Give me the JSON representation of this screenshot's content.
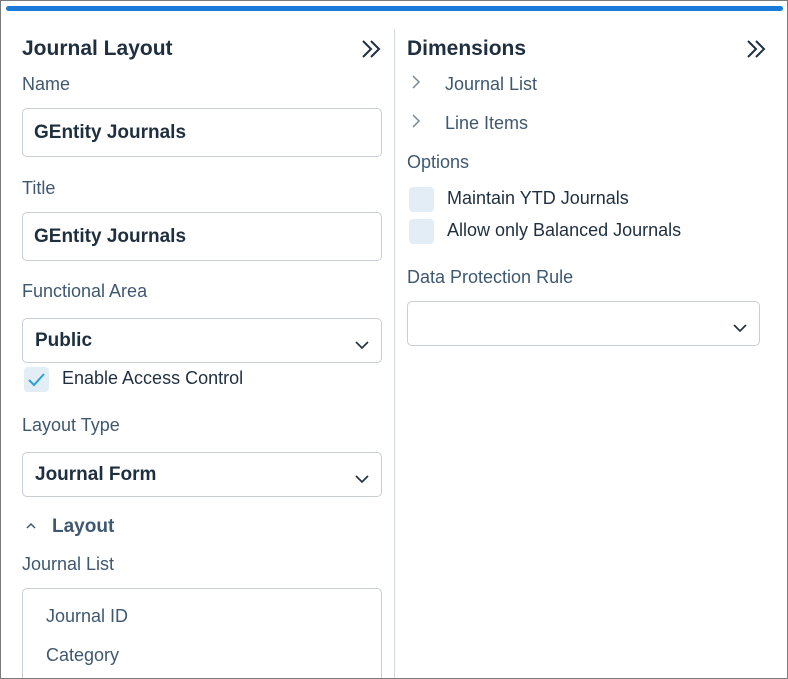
{
  "left_panel": {
    "title": "Journal Layout",
    "name_label": "Name",
    "name_value": "GEntity Journals",
    "title_label": "Title",
    "title_value": "GEntity Journals",
    "functional_area_label": "Functional Area",
    "functional_area_value": "Public",
    "enable_access_control_label": "Enable Access Control",
    "enable_access_control_checked": true,
    "layout_type_label": "Layout Type",
    "layout_type_value": "Journal Form",
    "layout_section_label": "Layout",
    "journal_list_label": "Journal List",
    "journal_list_items": [
      "Journal ID",
      "Category"
    ]
  },
  "right_panel": {
    "title": "Dimensions",
    "tree_items": [
      "Journal List",
      "Line Items"
    ],
    "options_label": "Options",
    "options": [
      {
        "label": "Maintain YTD Journals",
        "checked": false
      },
      {
        "label": "Allow only Balanced Journals",
        "checked": false
      }
    ],
    "data_protection_label": "Data Protection Rule",
    "data_protection_value": ""
  },
  "colors": {
    "accent": "#1a7ad9",
    "title_text": "#1f2f3f",
    "label_text": "#3f5870",
    "checkbox_bg": "#e3edf6",
    "check_mark": "#2b9fd6"
  },
  "icons": {
    "collapse": "double-chevron-right-icon",
    "dropdown": "chevron-down-icon",
    "tree_expand": "chevron-right-icon",
    "section_collapse": "chevron-up-icon",
    "check": "checkmark-icon"
  }
}
